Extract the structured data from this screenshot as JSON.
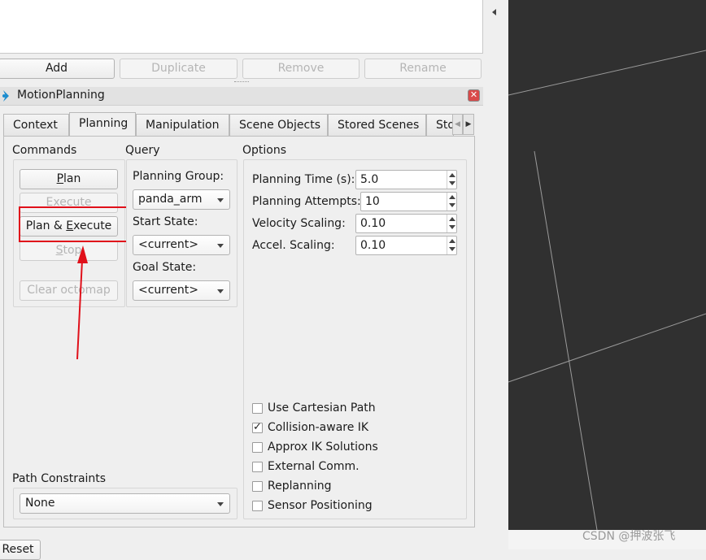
{
  "list_buttons": {
    "add": "Add",
    "duplicate": "Duplicate",
    "remove": "Remove",
    "rename": "Rename"
  },
  "panel": {
    "title": "MotionPlanning"
  },
  "tabs": [
    "Context",
    "Planning",
    "Manipulation",
    "Scene Objects",
    "Stored Scenes",
    "Sto"
  ],
  "commands": {
    "label": "Commands",
    "plan": {
      "pre": "",
      "mn": "P",
      "post": "lan"
    },
    "execute": {
      "pre": "",
      "mn": "E",
      "post": "xecute"
    },
    "plan_execute": {
      "pre": "Plan & ",
      "mn": "E",
      "post": "xecute"
    },
    "stop": {
      "pre": "",
      "mn": "S",
      "post": "top"
    },
    "clear_octomap": "Clear octomap"
  },
  "query": {
    "label": "Query",
    "planning_group_label": "Planning Group:",
    "planning_group_value": "panda_arm",
    "start_state_label": "Start State:",
    "start_state_value": "<current>",
    "goal_state_label": "Goal State:",
    "goal_state_value": "<current>"
  },
  "options": {
    "label": "Options",
    "planning_time_label": "Planning Time (s):",
    "planning_time_value": "5.0",
    "planning_attempts_label": "Planning Attempts:",
    "planning_attempts_value": "10",
    "velocity_scaling_label": "Velocity Scaling:",
    "velocity_scaling_value": "0.10",
    "accel_scaling_label": "Accel. Scaling:",
    "accel_scaling_value": "0.10",
    "checkboxes": [
      {
        "label": "Use Cartesian Path",
        "checked": false
      },
      {
        "label": "Collision-aware IK",
        "checked": true
      },
      {
        "label": "Approx IK Solutions",
        "checked": false
      },
      {
        "label": "External Comm.",
        "checked": false
      },
      {
        "label": "Replanning",
        "checked": false
      },
      {
        "label": "Sensor Positioning",
        "checked": false
      }
    ]
  },
  "path_constraints": {
    "label": "Path Constraints",
    "value": "None"
  },
  "reset_label": "Reset",
  "watermark": "CSDN @押波张飞",
  "colors": {
    "highlight_box": "#e0101a",
    "viewport_bg": "#303030",
    "grid_line": "#a0a0a0"
  }
}
